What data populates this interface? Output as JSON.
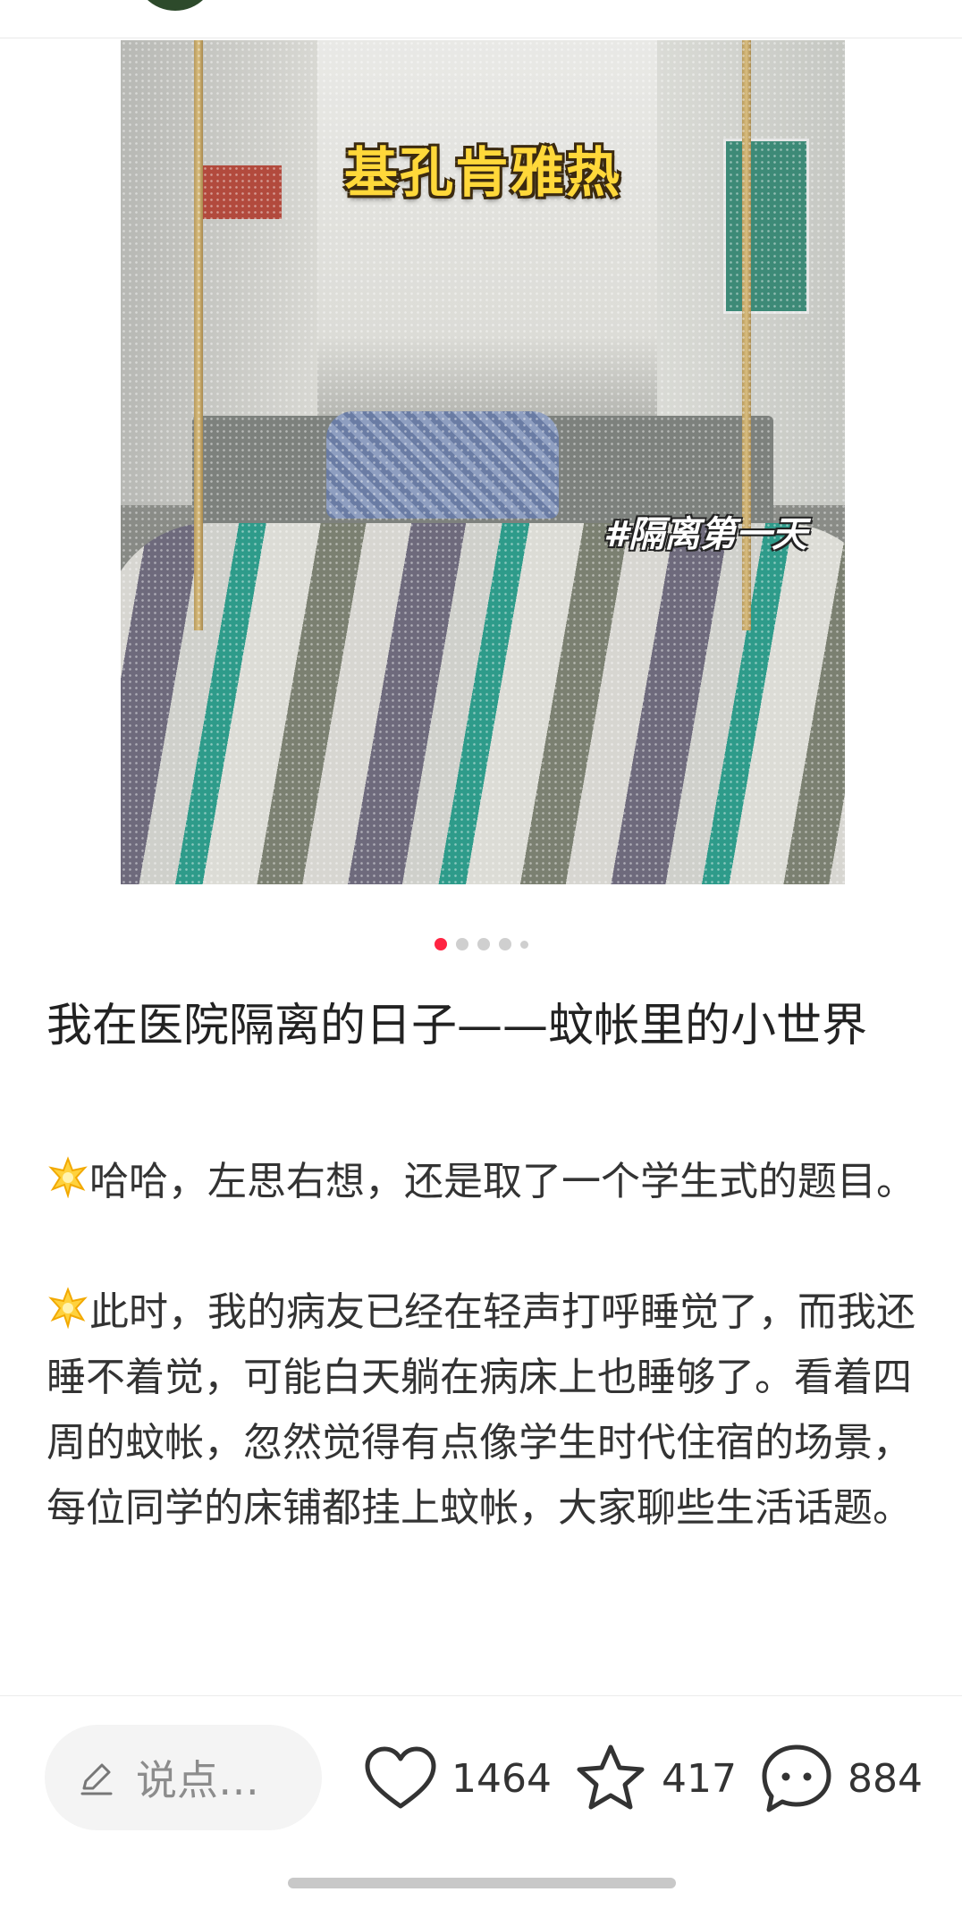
{
  "header": {},
  "photo": {
    "overlay_title": "基孔肯雅热",
    "overlay_tag": "#隔离第一天"
  },
  "carousel": {
    "total": 5,
    "active_index": 0
  },
  "post": {
    "title": "我在医院隔离的日子——蚊帐里的小世界",
    "paragraph_1": "哈哈，左思右想，还是取了一个学生式的题目。",
    "paragraph_2": "此时，我的病友已经在轻声打呼睡觉了，而我还睡不着觉，可能白天躺在病床上也睡够了。看着四周的蚊帐，忽然觉得有点像学生时代住宿的场景，每位同学的床铺都挂上蚊帐，大家聊些生活话题。"
  },
  "bottom_bar": {
    "comment_placeholder": "说点…",
    "likes": "1464",
    "favorites": "417",
    "comments": "884"
  },
  "icons": {
    "paragraph_marker": "sparkle-star-icon",
    "edit": "pencil-icon",
    "like": "heart-outline-icon",
    "favorite": "star-outline-icon",
    "comment": "chat-bubble-icon"
  },
  "colors": {
    "accent": "#ff2442",
    "overlay_title": "#ffd83a"
  }
}
